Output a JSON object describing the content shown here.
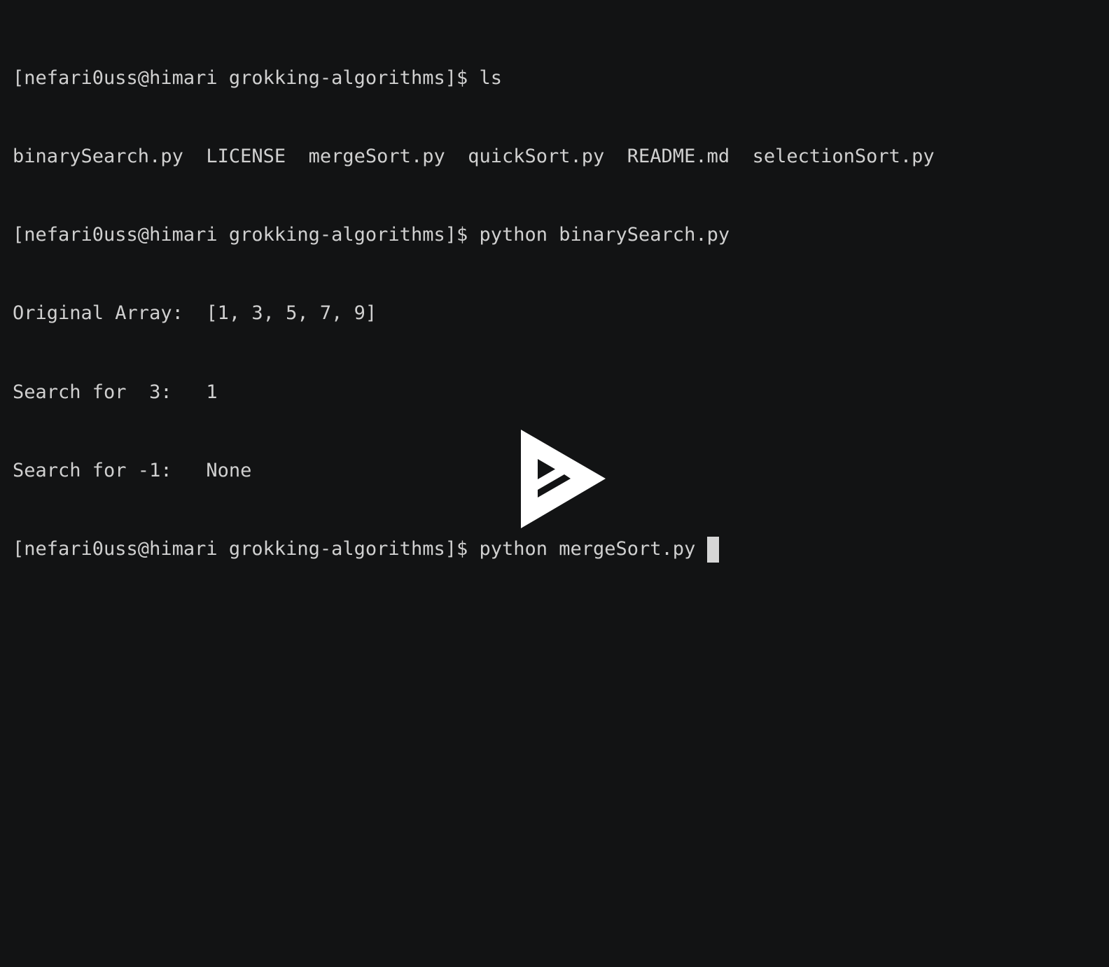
{
  "terminal": {
    "lines": [
      "[nefari0uss@himari grokking-algorithms]$ ls",
      "binarySearch.py  LICENSE  mergeSort.py  quickSort.py  README.md  selectionSort.py",
      "[nefari0uss@himari grokking-algorithms]$ python binarySearch.py",
      "Original Array:  [1, 3, 5, 7, 9]",
      "Search for  3:   1",
      "Search for -1:   None",
      "[nefari0uss@himari grokking-algorithms]$ python mergeSort.py "
    ]
  },
  "overlay": {
    "icon": "asciinema-play-icon",
    "color": "#ffffff"
  },
  "colors": {
    "background": "#121314",
    "text": "#d0d0d0",
    "cursor": "#d6d6d6"
  }
}
